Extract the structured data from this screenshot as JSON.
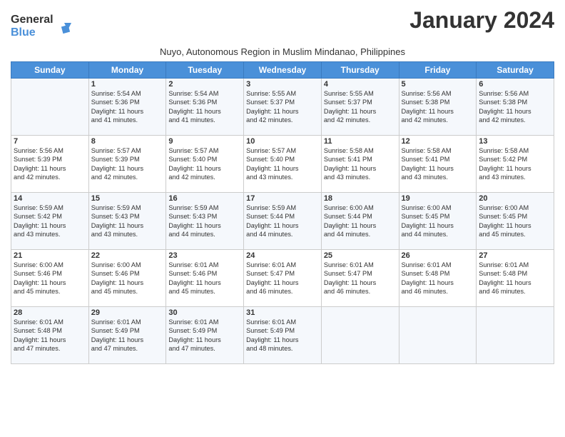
{
  "logo": {
    "line1": "General",
    "line2": "Blue"
  },
  "title": "January 2024",
  "subtitle": "Nuyo, Autonomous Region in Muslim Mindanao, Philippines",
  "header": {
    "days": [
      "Sunday",
      "Monday",
      "Tuesday",
      "Wednesday",
      "Thursday",
      "Friday",
      "Saturday"
    ]
  },
  "weeks": [
    [
      {
        "day": "",
        "data": ""
      },
      {
        "day": "1",
        "data": "Sunrise: 5:54 AM\nSunset: 5:36 PM\nDaylight: 11 hours\nand 41 minutes."
      },
      {
        "day": "2",
        "data": "Sunrise: 5:54 AM\nSunset: 5:36 PM\nDaylight: 11 hours\nand 41 minutes."
      },
      {
        "day": "3",
        "data": "Sunrise: 5:55 AM\nSunset: 5:37 PM\nDaylight: 11 hours\nand 42 minutes."
      },
      {
        "day": "4",
        "data": "Sunrise: 5:55 AM\nSunset: 5:37 PM\nDaylight: 11 hours\nand 42 minutes."
      },
      {
        "day": "5",
        "data": "Sunrise: 5:56 AM\nSunset: 5:38 PM\nDaylight: 11 hours\nand 42 minutes."
      },
      {
        "day": "6",
        "data": "Sunrise: 5:56 AM\nSunset: 5:38 PM\nDaylight: 11 hours\nand 42 minutes."
      }
    ],
    [
      {
        "day": "7",
        "data": "Sunrise: 5:56 AM\nSunset: 5:39 PM\nDaylight: 11 hours\nand 42 minutes."
      },
      {
        "day": "8",
        "data": "Sunrise: 5:57 AM\nSunset: 5:39 PM\nDaylight: 11 hours\nand 42 minutes."
      },
      {
        "day": "9",
        "data": "Sunrise: 5:57 AM\nSunset: 5:40 PM\nDaylight: 11 hours\nand 42 minutes."
      },
      {
        "day": "10",
        "data": "Sunrise: 5:57 AM\nSunset: 5:40 PM\nDaylight: 11 hours\nand 43 minutes."
      },
      {
        "day": "11",
        "data": "Sunrise: 5:58 AM\nSunset: 5:41 PM\nDaylight: 11 hours\nand 43 minutes."
      },
      {
        "day": "12",
        "data": "Sunrise: 5:58 AM\nSunset: 5:41 PM\nDaylight: 11 hours\nand 43 minutes."
      },
      {
        "day": "13",
        "data": "Sunrise: 5:58 AM\nSunset: 5:42 PM\nDaylight: 11 hours\nand 43 minutes."
      }
    ],
    [
      {
        "day": "14",
        "data": "Sunrise: 5:59 AM\nSunset: 5:42 PM\nDaylight: 11 hours\nand 43 minutes."
      },
      {
        "day": "15",
        "data": "Sunrise: 5:59 AM\nSunset: 5:43 PM\nDaylight: 11 hours\nand 43 minutes."
      },
      {
        "day": "16",
        "data": "Sunrise: 5:59 AM\nSunset: 5:43 PM\nDaylight: 11 hours\nand 44 minutes."
      },
      {
        "day": "17",
        "data": "Sunrise: 5:59 AM\nSunset: 5:44 PM\nDaylight: 11 hours\nand 44 minutes."
      },
      {
        "day": "18",
        "data": "Sunrise: 6:00 AM\nSunset: 5:44 PM\nDaylight: 11 hours\nand 44 minutes."
      },
      {
        "day": "19",
        "data": "Sunrise: 6:00 AM\nSunset: 5:45 PM\nDaylight: 11 hours\nand 44 minutes."
      },
      {
        "day": "20",
        "data": "Sunrise: 6:00 AM\nSunset: 5:45 PM\nDaylight: 11 hours\nand 45 minutes."
      }
    ],
    [
      {
        "day": "21",
        "data": "Sunrise: 6:00 AM\nSunset: 5:46 PM\nDaylight: 11 hours\nand 45 minutes."
      },
      {
        "day": "22",
        "data": "Sunrise: 6:00 AM\nSunset: 5:46 PM\nDaylight: 11 hours\nand 45 minutes."
      },
      {
        "day": "23",
        "data": "Sunrise: 6:01 AM\nSunset: 5:46 PM\nDaylight: 11 hours\nand 45 minutes."
      },
      {
        "day": "24",
        "data": "Sunrise: 6:01 AM\nSunset: 5:47 PM\nDaylight: 11 hours\nand 46 minutes."
      },
      {
        "day": "25",
        "data": "Sunrise: 6:01 AM\nSunset: 5:47 PM\nDaylight: 11 hours\nand 46 minutes."
      },
      {
        "day": "26",
        "data": "Sunrise: 6:01 AM\nSunset: 5:48 PM\nDaylight: 11 hours\nand 46 minutes."
      },
      {
        "day": "27",
        "data": "Sunrise: 6:01 AM\nSunset: 5:48 PM\nDaylight: 11 hours\nand 46 minutes."
      }
    ],
    [
      {
        "day": "28",
        "data": "Sunrise: 6:01 AM\nSunset: 5:48 PM\nDaylight: 11 hours\nand 47 minutes."
      },
      {
        "day": "29",
        "data": "Sunrise: 6:01 AM\nSunset: 5:49 PM\nDaylight: 11 hours\nand 47 minutes."
      },
      {
        "day": "30",
        "data": "Sunrise: 6:01 AM\nSunset: 5:49 PM\nDaylight: 11 hours\nand 47 minutes."
      },
      {
        "day": "31",
        "data": "Sunrise: 6:01 AM\nSunset: 5:49 PM\nDaylight: 11 hours\nand 48 minutes."
      },
      {
        "day": "",
        "data": ""
      },
      {
        "day": "",
        "data": ""
      },
      {
        "day": "",
        "data": ""
      }
    ]
  ]
}
